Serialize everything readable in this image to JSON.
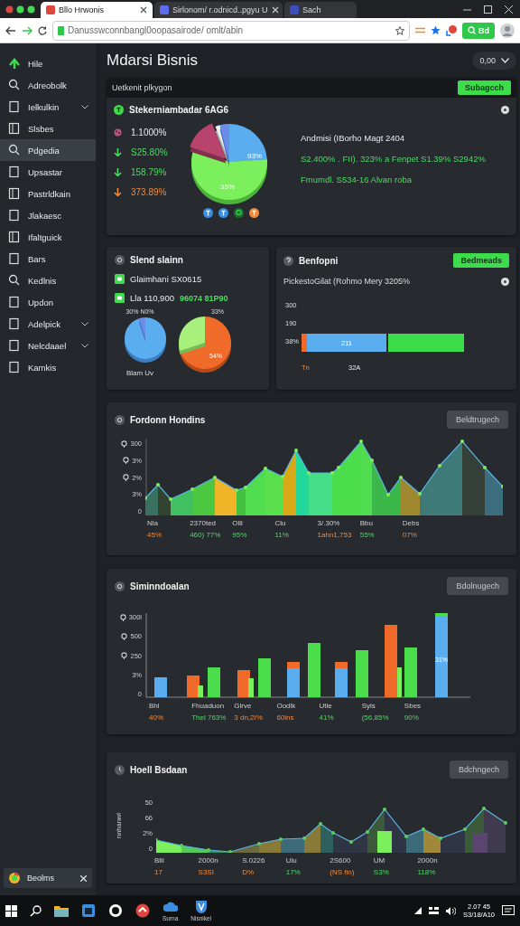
{
  "browser": {
    "tabs": [
      {
        "title": "Bllo Hrwonis",
        "selected": true
      },
      {
        "title": "Sirlonom/ r.odnicd..pgyu  U",
        "selected": false
      },
      {
        "title": "Sach",
        "selected": false
      }
    ],
    "address": "Danusswconnbangl0oopasairode/ omlt/abin",
    "account_button": "Bd"
  },
  "sidebar": {
    "items": [
      {
        "label": "Hile",
        "selected": false,
        "expandable": false
      },
      {
        "label": "Adreobolk",
        "selected": false,
        "expandable": false
      },
      {
        "label": "Ielkulkin",
        "selected": false,
        "expandable": true
      },
      {
        "label": "Slsbes",
        "selected": false,
        "expandable": false
      },
      {
        "label": "Pdgedia",
        "selected": true,
        "expandable": false
      },
      {
        "label": "Upsastar",
        "selected": false,
        "expandable": false
      },
      {
        "label": "Pastrldkain",
        "selected": false,
        "expandable": false
      },
      {
        "label": "Jlakaesc",
        "selected": false,
        "expandable": false
      },
      {
        "label": "Ifaltguick",
        "selected": false,
        "expandable": false
      },
      {
        "label": "Bars",
        "selected": false,
        "expandable": false
      },
      {
        "label": "Kedlnis",
        "selected": false,
        "expandable": false
      },
      {
        "label": "Updon",
        "selected": false,
        "expandable": false
      },
      {
        "label": "Adelpick",
        "selected": false,
        "expandable": true
      },
      {
        "label": "Nelcdaael",
        "selected": false,
        "expandable": true
      },
      {
        "label": "Kamkis",
        "selected": false,
        "expandable": false
      }
    ],
    "footer": "Beolms"
  },
  "header": {
    "title": "Mdarsi Bisnis",
    "picker": "0,00"
  },
  "overview": {
    "banner": "Uetkenit plkygon",
    "button": "Subagcch",
    "title": "Stekerniambadar 6AG6",
    "stats": [
      {
        "value": "1.1000%",
        "kind": "neutral"
      },
      {
        "value": "S25.80%",
        "kind": "positive"
      },
      {
        "value": "158.79%",
        "kind": "positive"
      },
      {
        "value": "373.89%",
        "kind": "negative"
      }
    ],
    "pie_labels": [
      "93%",
      "35%"
    ],
    "notes": [
      {
        "text": "Andmisi (IBorho Magt 2404",
        "kind": "neutral"
      },
      {
        "text": "S2.400% . FII). 323% a Fenpet  S1.39%  S2942%",
        "kind": "positive"
      },
      {
        "text": "Fmumdl.  S534-16  Alvan roba",
        "kind": "positive"
      }
    ]
  },
  "status": {
    "title": "Slend slainn",
    "rows": [
      {
        "label": "Glaimhani SX0615"
      },
      {
        "label": "Lla 110,900",
        "value": "96074 81P90"
      }
    ],
    "pie_labels": [
      "30% N0%",
      "Blam Uv",
      "33%",
      "54%"
    ]
  },
  "report": {
    "title": "Benfopni",
    "button": "Bedmeads",
    "subtitle": "PickestoGilat (Rohmo Mery 3205%",
    "yticks": [
      "300",
      "190",
      "38%"
    ],
    "bar_label": "211",
    "x_labels": [
      {
        "text": "Tn",
        "kind": "negative"
      },
      {
        "text": "32A",
        "kind": "neutral"
      }
    ]
  },
  "trend_chart": {
    "title": "Fordonn Hondins",
    "button": "Beldtrugech",
    "yticks": [
      "300",
      "3%",
      "2%",
      "3%",
      "0"
    ],
    "columns": [
      {
        "label": "Nla",
        "value": "45%",
        "kind": "negative"
      },
      {
        "label": "2370ted",
        "value": "460) 77%",
        "kind": "positive"
      },
      {
        "label": "Olli",
        "value": "95%",
        "kind": "positive"
      },
      {
        "label": "Clu",
        "value": "11%",
        "kind": "positive"
      },
      {
        "label": "3/.30%",
        "value": "1ahn1,753",
        "kind": "negative"
      },
      {
        "label": "Bbu",
        "value": "55%",
        "kind": "positive"
      },
      {
        "label": "Debs",
        "value": "07%",
        "kind": "negative"
      }
    ]
  },
  "bar_chart": {
    "title": "Siminndoalan",
    "button": "Bdolnugech",
    "yticks": [
      "300l",
      "500",
      "250",
      "3%",
      "0"
    ],
    "bar_label": "31%",
    "columns": [
      {
        "label": "Bhl",
        "value": "40%",
        "kind": "negative"
      },
      {
        "label": "Fhuaduon",
        "value": "Thel 763%",
        "kind": "positive"
      },
      {
        "label": "Glrve",
        "value": "3 dn,2I%",
        "kind": "negative"
      },
      {
        "label": "Oodlk",
        "value": "60lns",
        "kind": "negative"
      },
      {
        "label": "Utle",
        "value": "41%",
        "kind": "positive"
      },
      {
        "label": "Syls",
        "value": "(56,85%",
        "kind": "positive"
      },
      {
        "label": "Sbes",
        "value": "90%",
        "kind": "positive"
      }
    ]
  },
  "history_chart": {
    "title": "Hoell Bsdaan",
    "button": "Bdchngech",
    "axis_title": "nnhanwl",
    "yticks": [
      "50",
      "66",
      "2%",
      "0"
    ],
    "columns": [
      {
        "label": "Blli",
        "value": "17",
        "kind": "negative"
      },
      {
        "label": "2000n",
        "value": "S3SI",
        "kind": "negative"
      },
      {
        "label": "S.0226",
        "value": "D%",
        "kind": "negative"
      },
      {
        "label": "Ulu",
        "value": "17%",
        "kind": "positive"
      },
      {
        "label": "2S600",
        "value": "(NS fin)",
        "kind": "negative"
      },
      {
        "label": "UM",
        "value": "S3%",
        "kind": "positive"
      },
      {
        "label": "2000n",
        "value": "118%",
        "kind": "positive"
      }
    ]
  },
  "taskbar": {
    "captions": [
      "Surna",
      "Nisnikel"
    ],
    "time": "2.07 45",
    "date": "S3/18/A10"
  }
}
